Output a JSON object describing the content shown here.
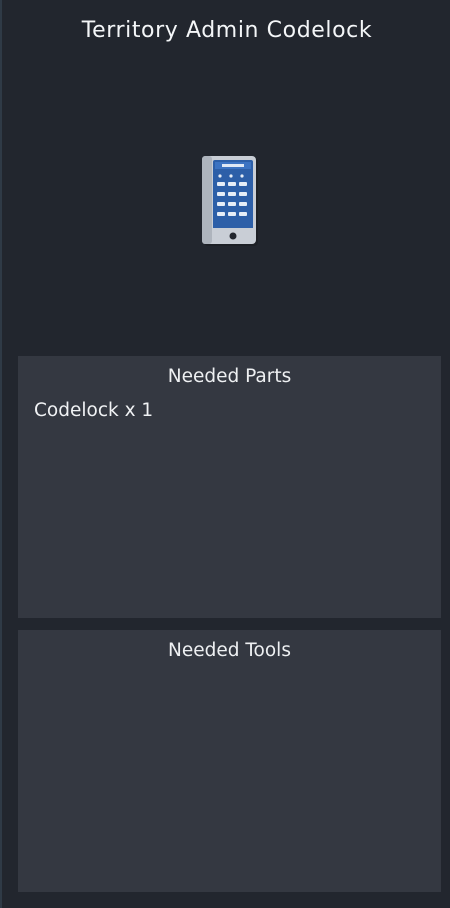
{
  "window": {
    "title": "Territory Admin Codelock"
  },
  "preview": {
    "icon": "codelock-keypad-icon",
    "accent_color": "#2d5fa8"
  },
  "needed_parts": {
    "title": "Needed Parts",
    "items": [
      {
        "label": "Codelock x 1"
      }
    ]
  },
  "needed_tools": {
    "title": "Needed Tools",
    "items": []
  }
}
